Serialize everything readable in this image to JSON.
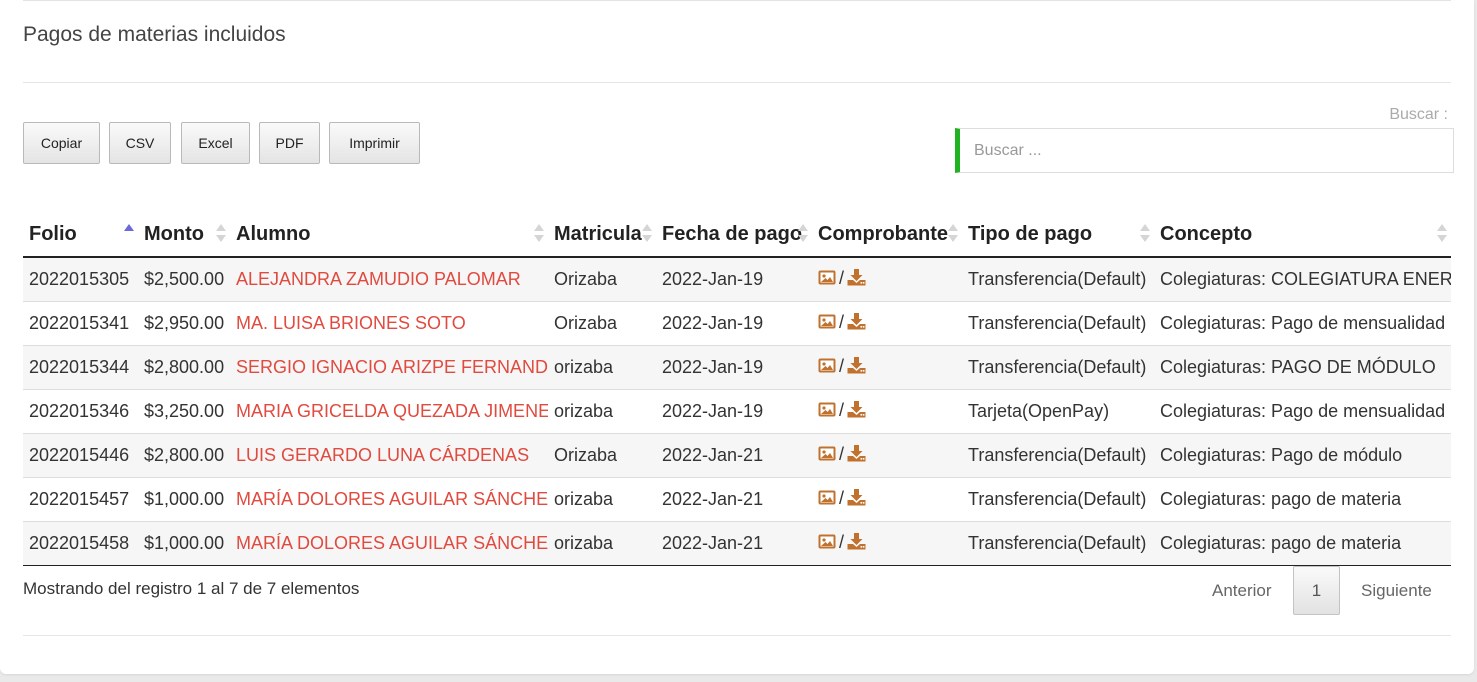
{
  "title": "Pagos de materias incluidos",
  "buttons": {
    "copy": "Copiar",
    "csv": "CSV",
    "excel": "Excel",
    "pdf": "PDF",
    "print": "Imprimir"
  },
  "search": {
    "label": "Buscar :",
    "placeholder": "Buscar ..."
  },
  "table": {
    "columns": [
      "Folio",
      "Monto",
      "Alumno",
      "Matricula",
      "Fecha de pago",
      "Comprobante",
      "Tipo de pago",
      "Concepto"
    ],
    "sorted_column": "Folio",
    "sort_direction": "asc",
    "comprobante_icons": [
      "image-icon",
      "download-icon"
    ],
    "comprobante_separator": "/",
    "rows": [
      {
        "folio": "2022015305",
        "monto": "$2,500.00",
        "alumno": "ALEJANDRA ZAMUDIO PALOMAR",
        "matricula": "Orizaba",
        "fecha": "2022-Jan-19",
        "tipo": "Transferencia(Default)",
        "concepto": "Colegiaturas: COLEGIATURA ENERO"
      },
      {
        "folio": "2022015341",
        "monto": "$2,950.00",
        "alumno": "MA. LUISA BRIONES SOTO",
        "matricula": "Orizaba",
        "fecha": "2022-Jan-19",
        "tipo": "Transferencia(Default)",
        "concepto": "Colegiaturas: Pago de mensualidad"
      },
      {
        "folio": "2022015344",
        "monto": "$2,800.00",
        "alumno": "SERGIO IGNACIO ARIZPE FERNANDEZ",
        "matricula": "orizaba",
        "fecha": "2022-Jan-19",
        "tipo": "Transferencia(Default)",
        "concepto": "Colegiaturas: PAGO DE MÓDULO"
      },
      {
        "folio": "2022015346",
        "monto": "$3,250.00",
        "alumno": "MARIA GRICELDA QUEZADA JIMENEZ",
        "matricula": "orizaba",
        "fecha": "2022-Jan-19",
        "tipo": "Tarjeta(OpenPay)",
        "concepto": "Colegiaturas: Pago de mensualidad"
      },
      {
        "folio": "2022015446",
        "monto": "$2,800.00",
        "alumno": "LUIS GERARDO LUNA CÁRDENAS",
        "matricula": "Orizaba",
        "fecha": "2022-Jan-21",
        "tipo": "Transferencia(Default)",
        "concepto": "Colegiaturas: Pago de módulo"
      },
      {
        "folio": "2022015457",
        "monto": "$1,000.00",
        "alumno": "MARÍA DOLORES AGUILAR SÁNCHEZ",
        "matricula": "orizaba",
        "fecha": "2022-Jan-21",
        "tipo": "Transferencia(Default)",
        "concepto": "Colegiaturas: pago de materia"
      },
      {
        "folio": "2022015458",
        "monto": "$1,000.00",
        "alumno": "MARÍA DOLORES AGUILAR SÁNCHEZ",
        "matricula": "orizaba",
        "fecha": "2022-Jan-21",
        "tipo": "Transferencia(Default)",
        "concepto": "Colegiaturas: pago de materia"
      }
    ]
  },
  "footer": {
    "info": "Mostrando del registro 1 al 7 de 7 elementos",
    "prev": "Anterior",
    "page": "1",
    "next": "Siguiente"
  },
  "colors": {
    "accent_search": "#1fb321",
    "student_link": "#e04a3f",
    "icon": "#c0712e",
    "sort_active": "#6a6ad8"
  }
}
